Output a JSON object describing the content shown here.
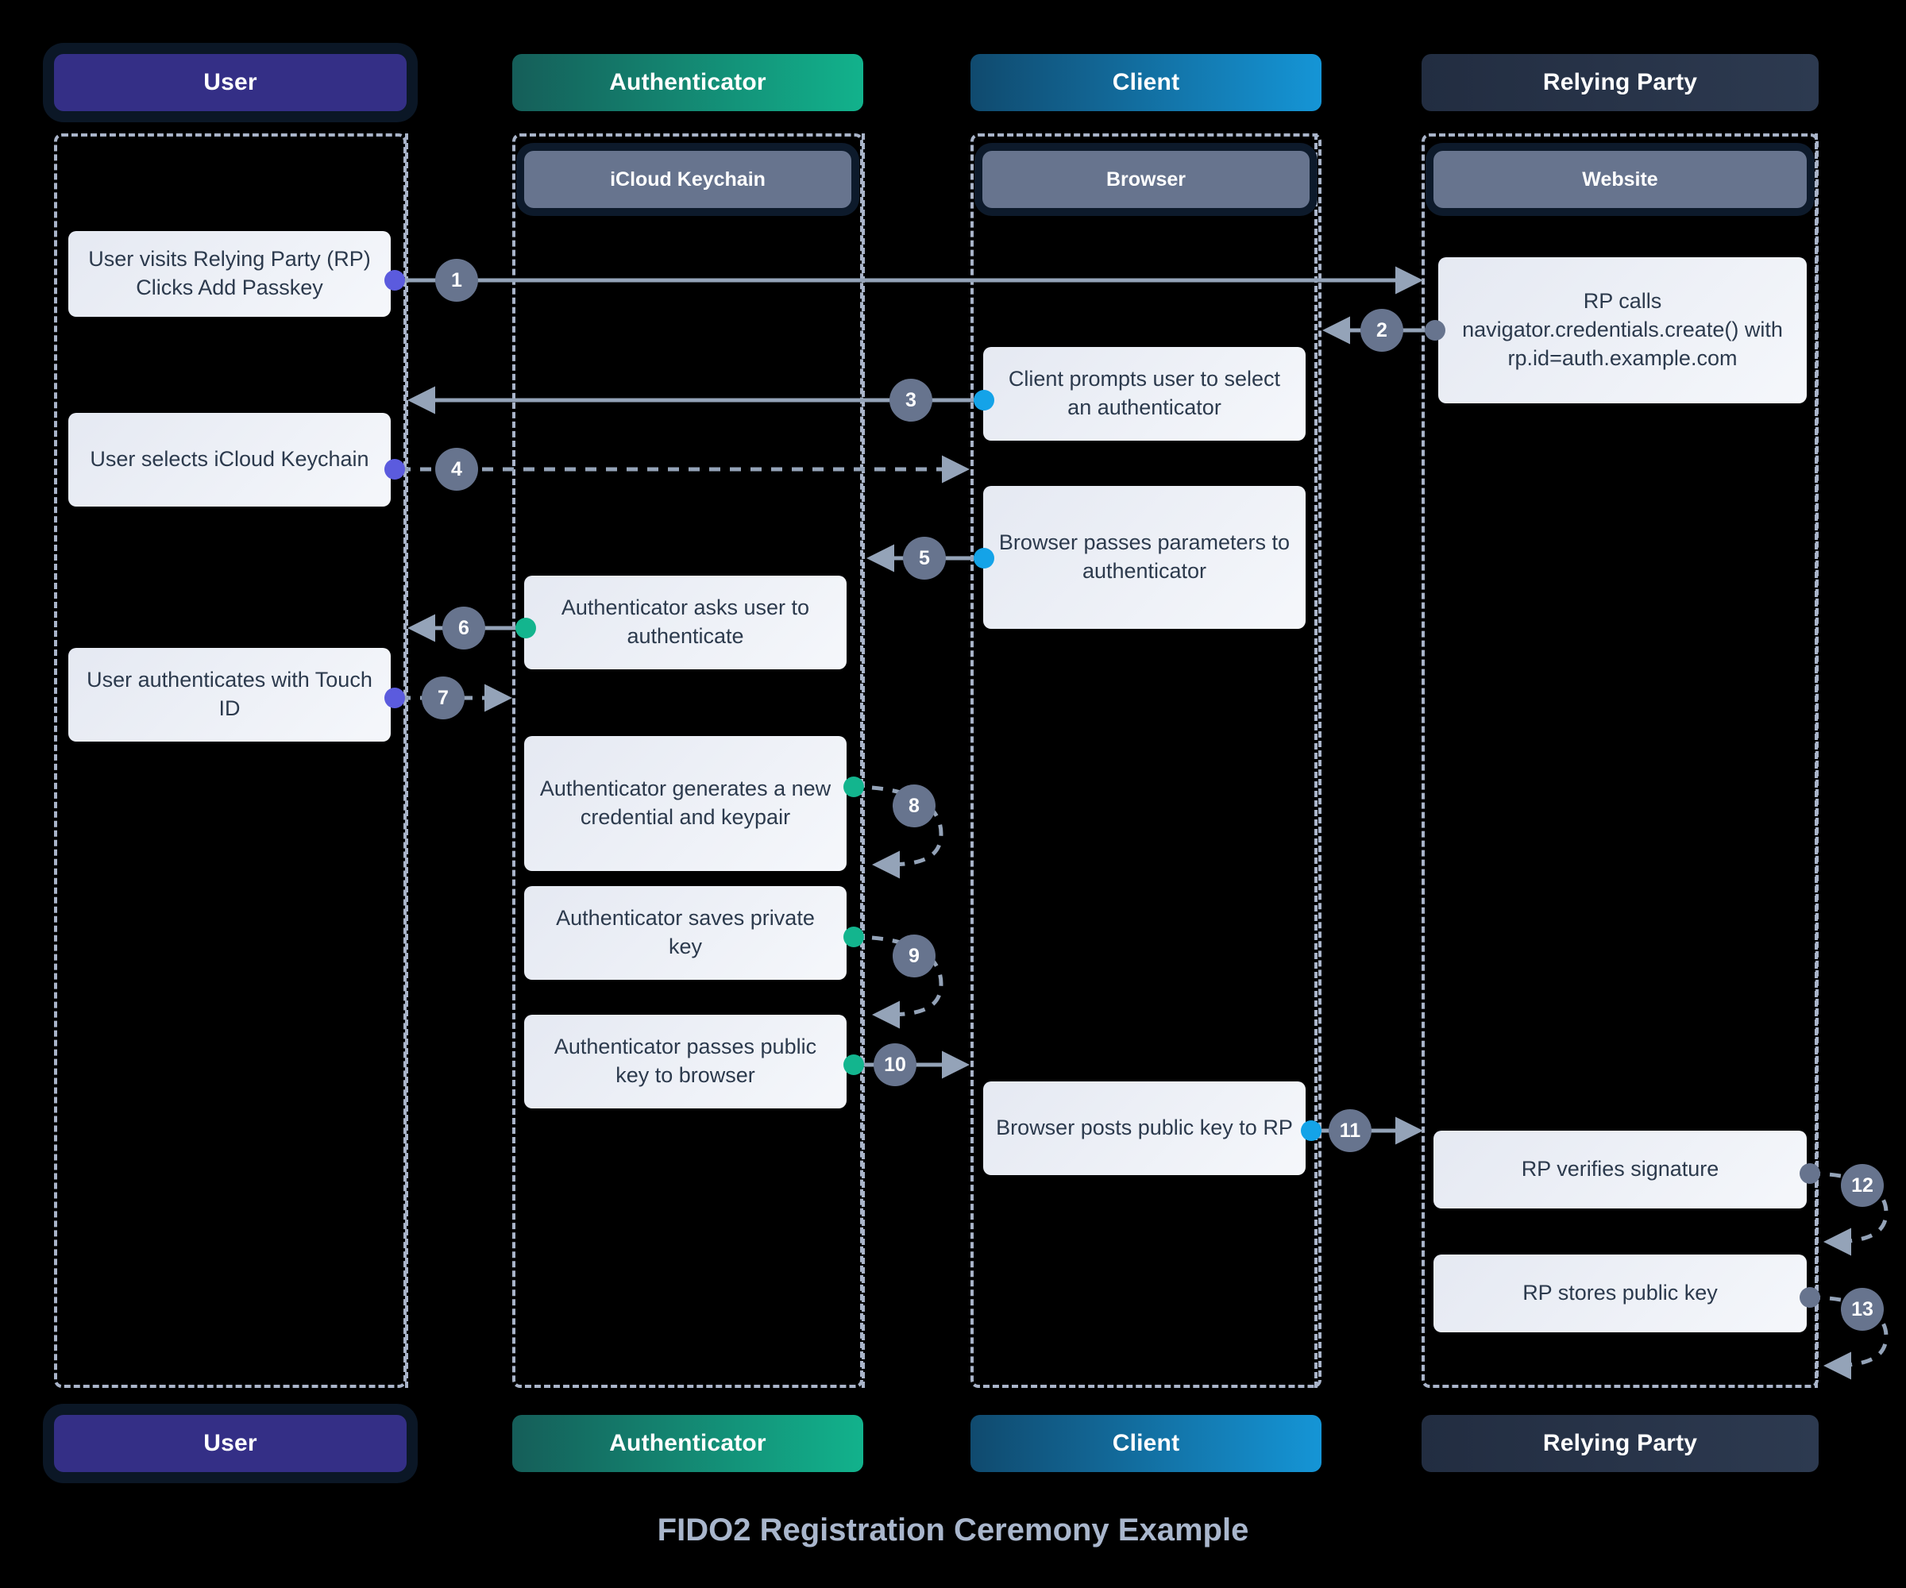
{
  "title": "FIDO2 Registration Ceremony Example",
  "colors": {
    "background": "#000000",
    "user": "#342f86",
    "user_dot": "#5b5bde",
    "authenticator_from": "#155e59",
    "authenticator_to": "#12b28c",
    "authenticator_dot": "#13b58e",
    "client_from": "#104a6e",
    "client_to": "#1595d6",
    "client_dot": "#14a3e8",
    "relying_party": "#2d3a50",
    "relying_party_dot": "#67748e",
    "lane_border": "#a9b4c9",
    "note_background": "#eef1f7",
    "note_text": "#2c3a4d",
    "step_badge": "#67748e",
    "title_text": "#a9b6cc",
    "system_box": "#67748e"
  },
  "lanes": [
    {
      "id": "user",
      "header": "User",
      "footer": "User",
      "system": null
    },
    {
      "id": "authenticator",
      "header": "Authenticator",
      "footer": "Authenticator",
      "system": "iCloud Keychain"
    },
    {
      "id": "client",
      "header": "Client",
      "footer": "Client",
      "system": "Browser"
    },
    {
      "id": "relyingparty",
      "header": "Relying Party",
      "footer": "Relying Party",
      "system": "Website"
    }
  ],
  "notes": [
    {
      "id": "note-1",
      "lane": "user",
      "text": "User visits Relying Party (RP) Clicks Add Passkey"
    },
    {
      "id": "note-2",
      "lane": "relyingparty",
      "text": "RP calls navigator.credentials.create() with rp.id=auth.example.com"
    },
    {
      "id": "note-3",
      "lane": "client",
      "text": "Client prompts user to select an authenticator"
    },
    {
      "id": "note-4",
      "lane": "user",
      "text": "User selects iCloud Keychain"
    },
    {
      "id": "note-5",
      "lane": "client",
      "text": "Browser passes parameters to authenticator"
    },
    {
      "id": "note-6",
      "lane": "authenticator",
      "text": "Authenticator asks user to authenticate"
    },
    {
      "id": "note-7",
      "lane": "user",
      "text": "User authenticates with Touch ID"
    },
    {
      "id": "note-8",
      "lane": "authenticator",
      "text": "Authenticator generates a new credential and keypair"
    },
    {
      "id": "note-9",
      "lane": "authenticator",
      "text": "Authenticator saves private key"
    },
    {
      "id": "note-10",
      "lane": "authenticator",
      "text": "Authenticator passes public key to browser"
    },
    {
      "id": "note-11",
      "lane": "client",
      "text": "Browser posts public key to RP"
    },
    {
      "id": "note-12",
      "lane": "relyingparty",
      "text": "RP verifies signature"
    },
    {
      "id": "note-13",
      "lane": "relyingparty",
      "text": "RP stores public key"
    }
  ],
  "steps": [
    {
      "number": "1",
      "from": "user",
      "to": "relyingparty",
      "style": "solid",
      "direction": "right"
    },
    {
      "number": "2",
      "from": "relyingparty",
      "to": "client",
      "style": "solid",
      "direction": "left"
    },
    {
      "number": "3",
      "from": "client",
      "to": "user",
      "style": "solid",
      "direction": "left"
    },
    {
      "number": "4",
      "from": "user",
      "to": "client",
      "style": "dashed",
      "direction": "right"
    },
    {
      "number": "5",
      "from": "client",
      "to": "authenticator",
      "style": "solid",
      "direction": "left"
    },
    {
      "number": "6",
      "from": "authenticator",
      "to": "user",
      "style": "solid",
      "direction": "left"
    },
    {
      "number": "7",
      "from": "user",
      "to": "authenticator",
      "style": "dashed",
      "direction": "right"
    },
    {
      "number": "8",
      "from": "authenticator",
      "to": "authenticator",
      "style": "dashed",
      "direction": "self"
    },
    {
      "number": "9",
      "from": "authenticator",
      "to": "authenticator",
      "style": "dashed",
      "direction": "self"
    },
    {
      "number": "10",
      "from": "authenticator",
      "to": "client",
      "style": "solid",
      "direction": "right"
    },
    {
      "number": "11",
      "from": "client",
      "to": "relyingparty",
      "style": "solid",
      "direction": "right"
    },
    {
      "number": "12",
      "from": "relyingparty",
      "to": "relyingparty",
      "style": "dashed",
      "direction": "self"
    },
    {
      "number": "13",
      "from": "relyingparty",
      "to": "relyingparty",
      "style": "dashed",
      "direction": "self"
    }
  ]
}
